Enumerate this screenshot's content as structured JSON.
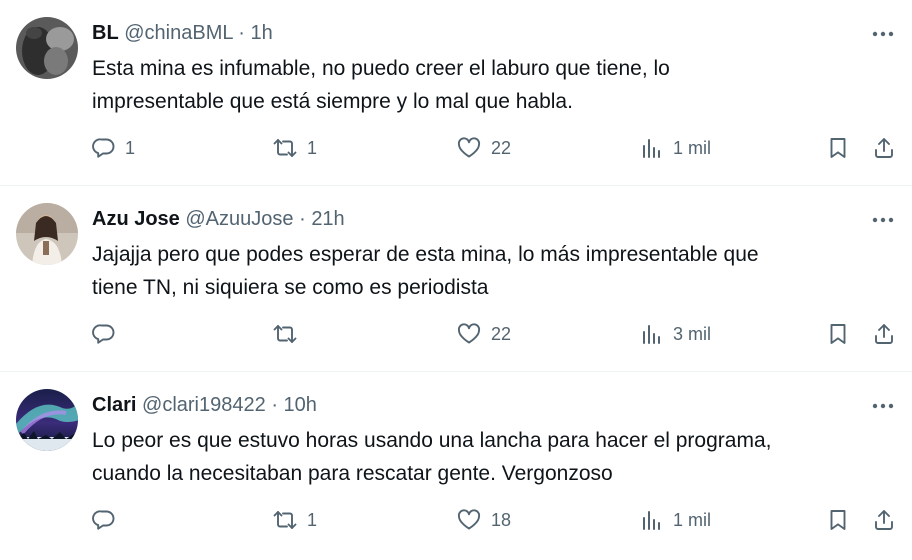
{
  "tweets": [
    {
      "name": "BL",
      "handle": "@chinaBML",
      "separator": "·",
      "time": "1h",
      "lines": [
        "Esta mina es infumable, no puedo creer el laburo que tiene, lo",
        "impresentable que está siempre y lo mal que habla."
      ],
      "replies": "1",
      "retweets": "1",
      "likes": "22",
      "views": "1 mil",
      "avatar": "bw-photo"
    },
    {
      "name": "Azu Jose",
      "handle": "@AzuuJose",
      "separator": "·",
      "time": "21h",
      "lines": [
        "Jajajja pero que podes esperar de esta mina, lo más impresentable que",
        "tiene TN, ni siquiera se como es periodista"
      ],
      "replies": "",
      "retweets": "",
      "likes": "22",
      "views": "3 mil",
      "avatar": "person-photo"
    },
    {
      "name": "Clari",
      "handle": "@clari198422",
      "separator": "·",
      "time": "10h",
      "lines": [
        "Lo peor es que estuvo horas usando una lancha para hacer el programa,",
        "cuando la necesitaban para rescatar gente. Vergonzoso"
      ],
      "replies": "",
      "retweets": "1",
      "likes": "18",
      "views": "1 mil",
      "avatar": "aurora-photo"
    }
  ],
  "icons": {
    "reply": "reply-icon",
    "retweet": "retweet-icon",
    "like": "heart-icon",
    "views": "views-icon",
    "bookmark": "bookmark-icon",
    "share": "share-icon",
    "more": "more-icon"
  },
  "colors": {
    "text": "#0f1419",
    "secondary": "#536471",
    "divider": "#eff3f4"
  }
}
